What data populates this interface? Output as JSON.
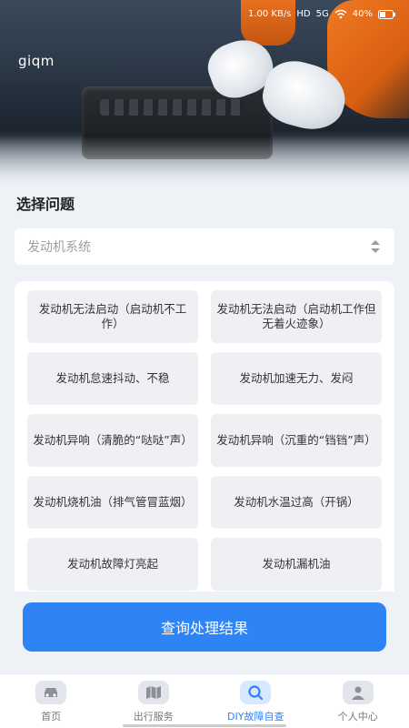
{
  "status_bar": {
    "time": "",
    "net_speed": "1.00 KB/s",
    "hd": "HD",
    "signal": "5G",
    "battery": "40%"
  },
  "brand": "giqm",
  "section_title": "选择问题",
  "select": {
    "placeholder": "发动机系统"
  },
  "options": [
    "发动机无法启动（启动机不工作）",
    "发动机无法启动（启动机工作但无着火迹象）",
    "发动机怠速抖动、不稳",
    "发动机加速无力、发闷",
    "发动机异响（清脆的“哒哒”声）",
    "发动机异响（沉重的“铛铛”声）",
    "发动机烧机油（排气管冒蓝烟）",
    "发动机水温过高（开锅）",
    "发动机故障灯亮起",
    "发动机漏机油"
  ],
  "submit_label": "查询处理结果",
  "tabs": [
    {
      "label": "首页",
      "icon": "car-icon",
      "active": false
    },
    {
      "label": "出行服务",
      "icon": "map-icon",
      "active": false
    },
    {
      "label": "DIY故障自查",
      "icon": "search-icon",
      "active": true
    },
    {
      "label": "个人中心",
      "icon": "user-icon",
      "active": false
    }
  ],
  "colors": {
    "accent": "#2e83f5",
    "background": "#eef1f6"
  }
}
